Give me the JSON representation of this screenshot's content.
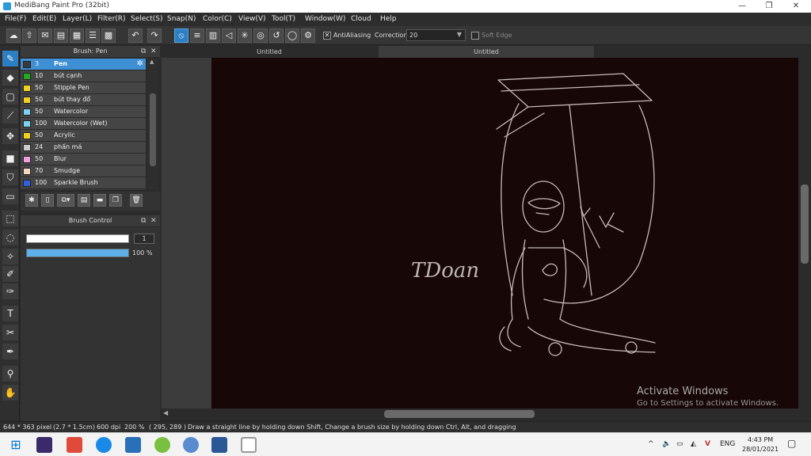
{
  "window": {
    "title": "MediBang Paint Pro (32bit)",
    "controls": {
      "minimize": "—",
      "restore": "❐",
      "close": "✕"
    }
  },
  "menu": [
    "File(F)",
    "Edit(E)",
    "Layer(L)",
    "Filter(R)",
    "Select(S)",
    "Snap(N)",
    "Color(C)",
    "View(V)",
    "Tool(T)",
    "Window(W)",
    "Cloud",
    "Help"
  ],
  "toolbar": {
    "antialiasing_label": "AntiAliasing",
    "antialiasing_checked": true,
    "correction_label": "Correction",
    "correction_value": "20",
    "soft_edge_label": "Soft Edge",
    "soft_edge_checked": false
  },
  "brush_panel": {
    "title": "Brush: Pen",
    "brushes": [
      {
        "size": "3",
        "name": "Pen",
        "color": "#3a3a3a",
        "selected": true
      },
      {
        "size": "10",
        "name": "bút cạnh",
        "color": "#22aa22",
        "selected": false
      },
      {
        "size": "50",
        "name": "Stipple Pen",
        "color": "#f0d020",
        "selected": false
      },
      {
        "size": "50",
        "name": "bút thay đổ",
        "color": "#f0d020",
        "selected": false
      },
      {
        "size": "50",
        "name": "Watercolor",
        "color": "#7fd0f0",
        "selected": false
      },
      {
        "size": "100",
        "name": "Watercolor (Wet)",
        "color": "#7fd0f0",
        "selected": false
      },
      {
        "size": "50",
        "name": "Acrylic",
        "color": "#f0d020",
        "selected": false
      },
      {
        "size": "24",
        "name": "phấn má",
        "color": "#cccccc",
        "selected": false
      },
      {
        "size": "50",
        "name": "Blur",
        "color": "#f0a0e0",
        "selected": false
      },
      {
        "size": "70",
        "name": "Smudge",
        "color": "#f5d8c0",
        "selected": false
      },
      {
        "size": "100",
        "name": "Sparkle Brush",
        "color": "#3060e0",
        "selected": false
      }
    ]
  },
  "brush_control": {
    "title": "Brush Control",
    "size_value": "1",
    "opacity_label": "100 %",
    "opacity_fraction": 1.0
  },
  "tabs": [
    "Untitled",
    "Untitled"
  ],
  "canvas": {
    "signature_text": "TDoan"
  },
  "watermark": {
    "line1": "Activate Windows",
    "line2": "Go to Settings to activate Windows."
  },
  "status": {
    "pixels": "644 * 363 pixel",
    "cm": "(2.7 * 1.5cm)",
    "dpi": "600 dpi",
    "zoom": "200 %",
    "coords": "( 295, 289 )",
    "hint": "Draw a straight line by holding down Shift, Change a brush size by holding down Ctrl, Alt, and dragging"
  },
  "taskbar": {
    "lang": "ENG",
    "time": "4:43 PM",
    "date": "28/01/2021"
  }
}
